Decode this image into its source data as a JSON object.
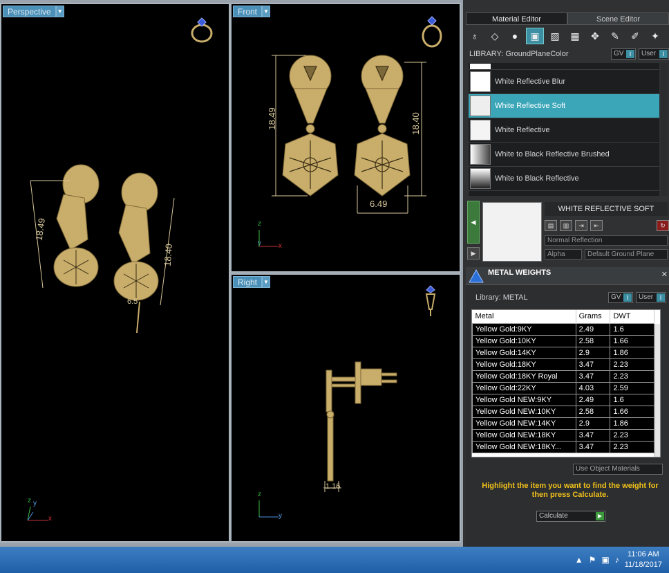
{
  "viewports": {
    "perspective": {
      "label": "Perspective",
      "dims": {
        "height_left": "18.49",
        "height_right": "18.40",
        "width": "6.5"
      }
    },
    "front": {
      "label": "Front",
      "dims": {
        "height_left": "18.49",
        "height_right": "18.40",
        "width": "6.49"
      }
    },
    "right": {
      "label": "Right",
      "dims": {
        "thickness": "1.16"
      }
    },
    "axes": {
      "x": "x",
      "y": "y",
      "z": "z"
    }
  },
  "material_editor": {
    "tabs": [
      {
        "label": "Material Editor"
      },
      {
        "label": "Scene Editor"
      }
    ],
    "library_label": "LIBRARY: GroundPlaneColor",
    "gv": "GV",
    "user": "User",
    "materials": [
      {
        "name": "White Reflective Blur"
      },
      {
        "name": "White Reflective Soft",
        "selected": true
      },
      {
        "name": "White Reflective"
      },
      {
        "name": "White to Black Reflective Brushed"
      },
      {
        "name": "White to Black Reflective"
      }
    ],
    "current_title": "WHITE REFLECTIVE SOFT",
    "reflection_type": "Normal Reflection",
    "alpha": "Alpha",
    "ground_plane": "Default Ground Plane"
  },
  "metal_weights": {
    "title": "METAL WEIGHTS",
    "library_label": "Library: METAL",
    "gv": "GV",
    "user": "User",
    "columns": [
      "Metal",
      "Grams",
      "DWT"
    ],
    "rows": [
      [
        "Yellow Gold:9KY",
        "2.49",
        "1.6"
      ],
      [
        "Yellow Gold:10KY",
        "2.58",
        "1.66"
      ],
      [
        "Yellow Gold:14KY",
        "2.9",
        "1.86"
      ],
      [
        "Yellow Gold:18KY",
        "3.47",
        "2.23"
      ],
      [
        "Yellow Gold:18KY Royal",
        "3.47",
        "2.23"
      ],
      [
        "Yellow Gold:22KY",
        "4.03",
        "2.59"
      ],
      [
        "Yellow Gold NEW:9KY",
        "2.49",
        "1.6"
      ],
      [
        "Yellow Gold NEW:10KY",
        "2.58",
        "1.66"
      ],
      [
        "Yellow Gold NEW:14KY",
        "2.9",
        "1.86"
      ],
      [
        "Yellow Gold NEW:18KY",
        "3.47",
        "2.23"
      ],
      [
        "Yellow Gold NEW:18KY...",
        "3.47",
        "2.23"
      ]
    ],
    "use_object_materials": "Use Object Materials",
    "hint": "Highlight the item you want to find the weight for then press Calculate.",
    "calculate": "Calculate"
  },
  "taskbar": {
    "time": "11:06 AM",
    "date": "11/18/2017"
  },
  "colors": {
    "accent": "#3aa6b8",
    "gold": "#c9ad6a",
    "hint": "#f2c21a"
  }
}
